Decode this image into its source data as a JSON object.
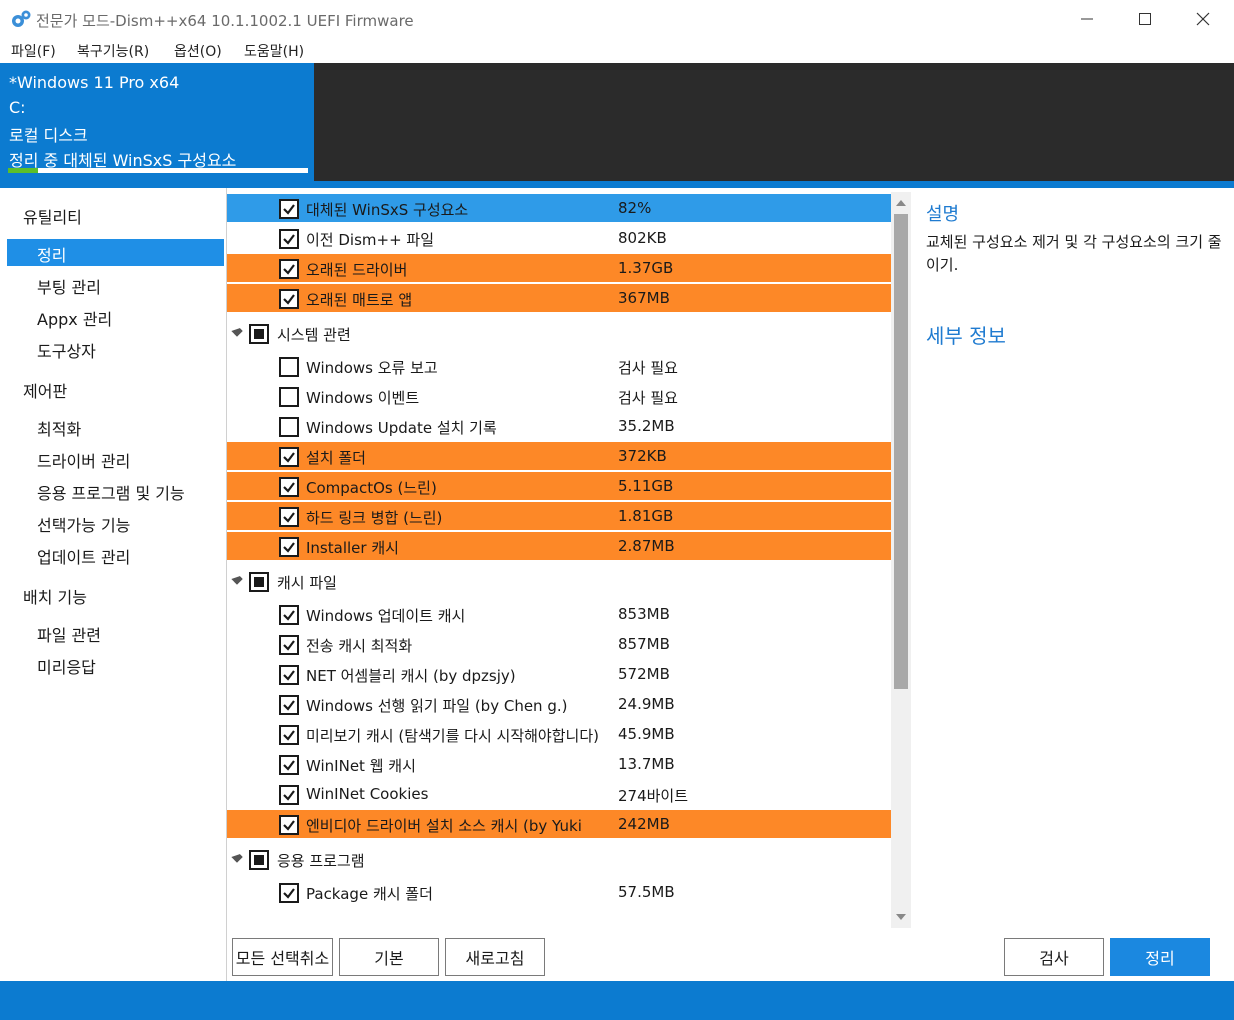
{
  "window": {
    "title": "전문가 모드-Dism++x64 10.1.1002.1 UEFI Firmware",
    "icon": "gears-icon"
  },
  "menu": [
    "파일(F)",
    "복구기능(R)",
    "옵션(O)",
    "도움말(H)"
  ],
  "image_panel": {
    "line1": "*Windows 11 Pro x64",
    "line2": "C:",
    "line3": "로컬 디스크",
    "line4": "정리 중 대체된 WinSxS 구성요소",
    "progress": 0.1
  },
  "sidebar": {
    "group_utility": "유틸리티",
    "item_cleanup": "정리",
    "item_boot": "부팅 관리",
    "item_appx": "Appx 관리",
    "item_toolbox": "도구상자",
    "group_control": "제어판",
    "item_optimize": "최적화",
    "item_driver": "드라이버 관리",
    "item_apps": "응용 프로그램 및 기능",
    "item_optional": "선택가능 기능",
    "item_update": "업데이트 관리",
    "group_deploy": "배치 기능",
    "item_file": "파일 관련",
    "item_answer": "미리응답"
  },
  "rows": [
    {
      "label": "대체된 WinSxS 구성요소",
      "size": "82%",
      "checked": true,
      "state": "selected"
    },
    {
      "label": "이전 Dism++ 파일",
      "size": "802KB",
      "checked": true,
      "state": "normal"
    },
    {
      "label": "오래된 드라이버",
      "size": "1.37GB",
      "checked": true,
      "state": "warning"
    },
    {
      "label": "오래된 매트로 앱",
      "size": "367MB",
      "checked": true,
      "state": "warning"
    }
  ],
  "categories": {
    "system": "시스템 관련",
    "cache": "캐시 파일",
    "apps": "응용 프로그램"
  },
  "system_rows": [
    {
      "label": "Windows 오류 보고",
      "size": "검사 필요",
      "checked": false,
      "state": "normal"
    },
    {
      "label": "Windows 이벤트",
      "size": "검사 필요",
      "checked": false,
      "state": "normal"
    },
    {
      "label": "Windows Update 설치 기록",
      "size": "35.2MB",
      "checked": false,
      "state": "normal"
    },
    {
      "label": "설치 폴더",
      "size": "372KB",
      "checked": true,
      "state": "warning"
    },
    {
      "label": "CompactOs (느린)",
      "size": "5.11GB",
      "checked": true,
      "state": "warning"
    },
    {
      "label": "하드 링크 병합 (느린)",
      "size": "1.81GB",
      "checked": true,
      "state": "warning"
    },
    {
      "label": "Installer 캐시",
      "size": "2.87MB",
      "checked": true,
      "state": "warning"
    }
  ],
  "cache_rows": [
    {
      "label": "Windows 업데이트 캐시",
      "size": "853MB",
      "checked": true,
      "state": "normal"
    },
    {
      "label": "전송 캐시 최적화",
      "size": "857MB",
      "checked": true,
      "state": "normal"
    },
    {
      "label": "NET 어셈블리 캐시 (by dpzsjy)",
      "size": "572MB",
      "checked": true,
      "state": "normal"
    },
    {
      "label": "Windows 선행 읽기 파일 (by Chen g.)",
      "size": "24.9MB",
      "checked": true,
      "state": "normal"
    },
    {
      "label": "미리보기 캐시 (탐색기를 다시 시작해야합니다)",
      "size": "45.9MB",
      "checked": true,
      "state": "normal"
    },
    {
      "label": "WinINet 웹 캐시",
      "size": "13.7MB",
      "checked": true,
      "state": "normal"
    },
    {
      "label": "WinINet Cookies",
      "size": "274바이트",
      "checked": true,
      "state": "normal"
    },
    {
      "label": "엔비디아 드라이버 설치 소스 캐시 (by Yuki",
      "size": "242MB",
      "checked": true,
      "state": "warning"
    }
  ],
  "app_rows": [
    {
      "label": "Package 캐시 폴더",
      "size": "57.5MB",
      "checked": true,
      "state": "normal"
    }
  ],
  "description": {
    "title": "설명",
    "body": "교체된 구성요소 제거 및 각 구성요소의 크기 줄이기.",
    "details_title": "세부 정보"
  },
  "buttons": {
    "deselect_all": "모든 선택취소",
    "default": "기본",
    "refresh": "새로고침",
    "scan": "검사",
    "cleanup": "정리"
  },
  "colors": {
    "accent": "#0c7bd0",
    "selected_row": "#2f9be8",
    "warning_row": "#fd8827",
    "progress": "#5cbf2a"
  }
}
